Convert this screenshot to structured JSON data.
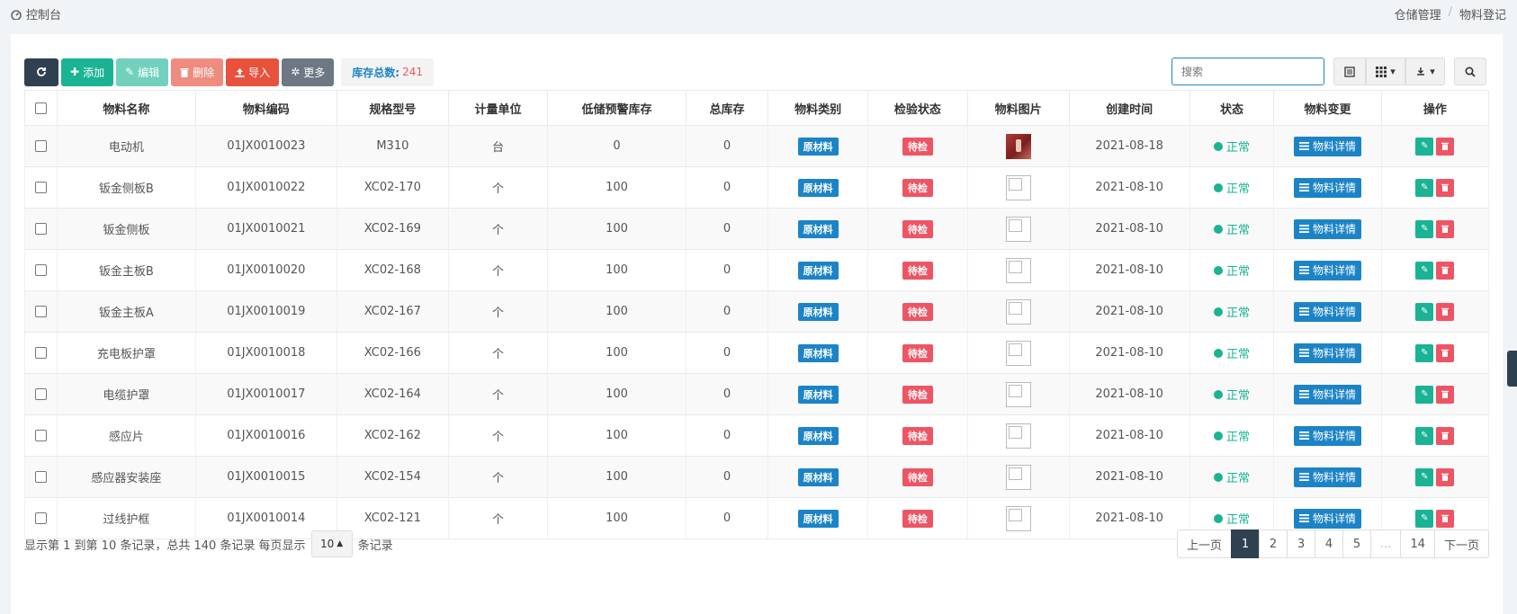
{
  "breadcrumb": {
    "left_label": "控制台",
    "right": [
      "仓储管理",
      "/",
      "物料登记"
    ]
  },
  "toolbar": {
    "add_label": "添加",
    "edit_label": "编辑",
    "delete_label": "删除",
    "import_label": "导入",
    "more_label": "更多",
    "stock_total_label": "库存总数:",
    "stock_total_value": "241"
  },
  "search": {
    "placeholder": "搜索"
  },
  "table": {
    "columns": [
      "物料名称",
      "物料编码",
      "规格型号",
      "计量单位",
      "低储预警库存",
      "总库存",
      "物料类别",
      "检验状态",
      "物料图片",
      "创建时间",
      "状态",
      "物料变更",
      "操作"
    ],
    "rows": [
      {
        "name": "电动机",
        "code": "01JX0010023",
        "spec": "M310",
        "unit": "台",
        "warn": "0",
        "total": "0",
        "category": "原材料",
        "inspect": "待检",
        "has_image": true,
        "created": "2021-08-18",
        "status": "正常",
        "detail": "物料详情"
      },
      {
        "name": "钣金侧板B",
        "code": "01JX0010022",
        "spec": "XC02-170",
        "unit": "个",
        "warn": "100",
        "total": "0",
        "category": "原材料",
        "inspect": "待检",
        "has_image": false,
        "created": "2021-08-10",
        "status": "正常",
        "detail": "物料详情"
      },
      {
        "name": "钣金侧板",
        "code": "01JX0010021",
        "spec": "XC02-169",
        "unit": "个",
        "warn": "100",
        "total": "0",
        "category": "原材料",
        "inspect": "待检",
        "has_image": false,
        "created": "2021-08-10",
        "status": "正常",
        "detail": "物料详情"
      },
      {
        "name": "钣金主板B",
        "code": "01JX0010020",
        "spec": "XC02-168",
        "unit": "个",
        "warn": "100",
        "total": "0",
        "category": "原材料",
        "inspect": "待检",
        "has_image": false,
        "created": "2021-08-10",
        "status": "正常",
        "detail": "物料详情"
      },
      {
        "name": "钣金主板A",
        "code": "01JX0010019",
        "spec": "XC02-167",
        "unit": "个",
        "warn": "100",
        "total": "0",
        "category": "原材料",
        "inspect": "待检",
        "has_image": false,
        "created": "2021-08-10",
        "status": "正常",
        "detail": "物料详情"
      },
      {
        "name": "充电板护罩",
        "code": "01JX0010018",
        "spec": "XC02-166",
        "unit": "个",
        "warn": "100",
        "total": "0",
        "category": "原材料",
        "inspect": "待检",
        "has_image": false,
        "created": "2021-08-10",
        "status": "正常",
        "detail": "物料详情"
      },
      {
        "name": "电缆护罩",
        "code": "01JX0010017",
        "spec": "XC02-164",
        "unit": "个",
        "warn": "100",
        "total": "0",
        "category": "原材料",
        "inspect": "待检",
        "has_image": false,
        "created": "2021-08-10",
        "status": "正常",
        "detail": "物料详情"
      },
      {
        "name": "感应片",
        "code": "01JX0010016",
        "spec": "XC02-162",
        "unit": "个",
        "warn": "100",
        "total": "0",
        "category": "原材料",
        "inspect": "待检",
        "has_image": false,
        "created": "2021-08-10",
        "status": "正常",
        "detail": "物料详情"
      },
      {
        "name": "感应器安装座",
        "code": "01JX0010015",
        "spec": "XC02-154",
        "unit": "个",
        "warn": "100",
        "total": "0",
        "category": "原材料",
        "inspect": "待检",
        "has_image": false,
        "created": "2021-08-10",
        "status": "正常",
        "detail": "物料详情"
      },
      {
        "name": "过线护框",
        "code": "01JX0010014",
        "spec": "XC02-121",
        "unit": "个",
        "warn": "100",
        "total": "0",
        "category": "原材料",
        "inspect": "待检",
        "has_image": false,
        "created": "2021-08-10",
        "status": "正常",
        "detail": "物料详情"
      }
    ]
  },
  "footer": {
    "info_prefix": "显示第 1 到第 10 条记录，总共 140 条记录 每页显示",
    "page_size": "10",
    "info_suffix": "条记录",
    "pages": [
      "上一页",
      "1",
      "2",
      "3",
      "4",
      "5",
      "...",
      "14",
      "下一页"
    ],
    "active_page": "1"
  },
  "colors": {
    "primary": "#1c84c6",
    "success": "#1ab394",
    "danger": "#ed5565",
    "dark": "#2f4050"
  }
}
